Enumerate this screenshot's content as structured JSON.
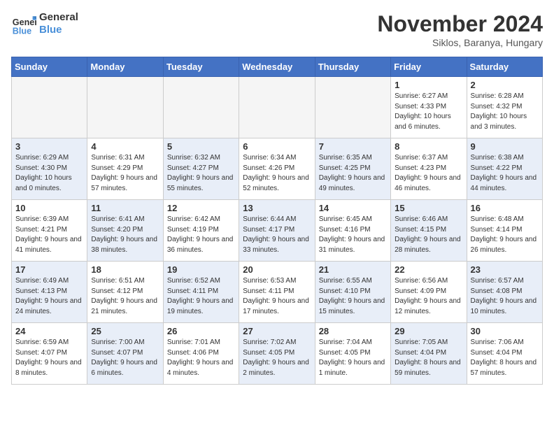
{
  "header": {
    "logo_line1": "General",
    "logo_line2": "Blue",
    "month_title": "November 2024",
    "location": "Siklos, Baranya, Hungary"
  },
  "days_of_week": [
    "Sunday",
    "Monday",
    "Tuesday",
    "Wednesday",
    "Thursday",
    "Friday",
    "Saturday"
  ],
  "weeks": [
    [
      {
        "day": "",
        "empty": true
      },
      {
        "day": "",
        "empty": true
      },
      {
        "day": "",
        "empty": true
      },
      {
        "day": "",
        "empty": true
      },
      {
        "day": "",
        "empty": true
      },
      {
        "day": "1",
        "sunrise": "Sunrise: 6:27 AM",
        "sunset": "Sunset: 4:33 PM",
        "daylight": "Daylight: 10 hours and 6 minutes."
      },
      {
        "day": "2",
        "sunrise": "Sunrise: 6:28 AM",
        "sunset": "Sunset: 4:32 PM",
        "daylight": "Daylight: 10 hours and 3 minutes."
      }
    ],
    [
      {
        "day": "3",
        "sunrise": "Sunrise: 6:29 AM",
        "sunset": "Sunset: 4:30 PM",
        "daylight": "Daylight: 10 hours and 0 minutes.",
        "shaded": true
      },
      {
        "day": "4",
        "sunrise": "Sunrise: 6:31 AM",
        "sunset": "Sunset: 4:29 PM",
        "daylight": "Daylight: 9 hours and 57 minutes.",
        "shaded": false
      },
      {
        "day": "5",
        "sunrise": "Sunrise: 6:32 AM",
        "sunset": "Sunset: 4:27 PM",
        "daylight": "Daylight: 9 hours and 55 minutes.",
        "shaded": true
      },
      {
        "day": "6",
        "sunrise": "Sunrise: 6:34 AM",
        "sunset": "Sunset: 4:26 PM",
        "daylight": "Daylight: 9 hours and 52 minutes.",
        "shaded": false
      },
      {
        "day": "7",
        "sunrise": "Sunrise: 6:35 AM",
        "sunset": "Sunset: 4:25 PM",
        "daylight": "Daylight: 9 hours and 49 minutes.",
        "shaded": true
      },
      {
        "day": "8",
        "sunrise": "Sunrise: 6:37 AM",
        "sunset": "Sunset: 4:23 PM",
        "daylight": "Daylight: 9 hours and 46 minutes.",
        "shaded": false
      },
      {
        "day": "9",
        "sunrise": "Sunrise: 6:38 AM",
        "sunset": "Sunset: 4:22 PM",
        "daylight": "Daylight: 9 hours and 44 minutes.",
        "shaded": true
      }
    ],
    [
      {
        "day": "10",
        "sunrise": "Sunrise: 6:39 AM",
        "sunset": "Sunset: 4:21 PM",
        "daylight": "Daylight: 9 hours and 41 minutes.",
        "shaded": false
      },
      {
        "day": "11",
        "sunrise": "Sunrise: 6:41 AM",
        "sunset": "Sunset: 4:20 PM",
        "daylight": "Daylight: 9 hours and 38 minutes.",
        "shaded": true
      },
      {
        "day": "12",
        "sunrise": "Sunrise: 6:42 AM",
        "sunset": "Sunset: 4:19 PM",
        "daylight": "Daylight: 9 hours and 36 minutes.",
        "shaded": false
      },
      {
        "day": "13",
        "sunrise": "Sunrise: 6:44 AM",
        "sunset": "Sunset: 4:17 PM",
        "daylight": "Daylight: 9 hours and 33 minutes.",
        "shaded": true
      },
      {
        "day": "14",
        "sunrise": "Sunrise: 6:45 AM",
        "sunset": "Sunset: 4:16 PM",
        "daylight": "Daylight: 9 hours and 31 minutes.",
        "shaded": false
      },
      {
        "day": "15",
        "sunrise": "Sunrise: 6:46 AM",
        "sunset": "Sunset: 4:15 PM",
        "daylight": "Daylight: 9 hours and 28 minutes.",
        "shaded": true
      },
      {
        "day": "16",
        "sunrise": "Sunrise: 6:48 AM",
        "sunset": "Sunset: 4:14 PM",
        "daylight": "Daylight: 9 hours and 26 minutes.",
        "shaded": false
      }
    ],
    [
      {
        "day": "17",
        "sunrise": "Sunrise: 6:49 AM",
        "sunset": "Sunset: 4:13 PM",
        "daylight": "Daylight: 9 hours and 24 minutes.",
        "shaded": true
      },
      {
        "day": "18",
        "sunrise": "Sunrise: 6:51 AM",
        "sunset": "Sunset: 4:12 PM",
        "daylight": "Daylight: 9 hours and 21 minutes.",
        "shaded": false
      },
      {
        "day": "19",
        "sunrise": "Sunrise: 6:52 AM",
        "sunset": "Sunset: 4:11 PM",
        "daylight": "Daylight: 9 hours and 19 minutes.",
        "shaded": true
      },
      {
        "day": "20",
        "sunrise": "Sunrise: 6:53 AM",
        "sunset": "Sunset: 4:11 PM",
        "daylight": "Daylight: 9 hours and 17 minutes.",
        "shaded": false
      },
      {
        "day": "21",
        "sunrise": "Sunrise: 6:55 AM",
        "sunset": "Sunset: 4:10 PM",
        "daylight": "Daylight: 9 hours and 15 minutes.",
        "shaded": true
      },
      {
        "day": "22",
        "sunrise": "Sunrise: 6:56 AM",
        "sunset": "Sunset: 4:09 PM",
        "daylight": "Daylight: 9 hours and 12 minutes.",
        "shaded": false
      },
      {
        "day": "23",
        "sunrise": "Sunrise: 6:57 AM",
        "sunset": "Sunset: 4:08 PM",
        "daylight": "Daylight: 9 hours and 10 minutes.",
        "shaded": true
      }
    ],
    [
      {
        "day": "24",
        "sunrise": "Sunrise: 6:59 AM",
        "sunset": "Sunset: 4:07 PM",
        "daylight": "Daylight: 9 hours and 8 minutes.",
        "shaded": false
      },
      {
        "day": "25",
        "sunrise": "Sunrise: 7:00 AM",
        "sunset": "Sunset: 4:07 PM",
        "daylight": "Daylight: 9 hours and 6 minutes.",
        "shaded": true
      },
      {
        "day": "26",
        "sunrise": "Sunrise: 7:01 AM",
        "sunset": "Sunset: 4:06 PM",
        "daylight": "Daylight: 9 hours and 4 minutes.",
        "shaded": false
      },
      {
        "day": "27",
        "sunrise": "Sunrise: 7:02 AM",
        "sunset": "Sunset: 4:05 PM",
        "daylight": "Daylight: 9 hours and 2 minutes.",
        "shaded": true
      },
      {
        "day": "28",
        "sunrise": "Sunrise: 7:04 AM",
        "sunset": "Sunset: 4:05 PM",
        "daylight": "Daylight: 9 hours and 1 minute.",
        "shaded": false
      },
      {
        "day": "29",
        "sunrise": "Sunrise: 7:05 AM",
        "sunset": "Sunset: 4:04 PM",
        "daylight": "Daylight: 8 hours and 59 minutes.",
        "shaded": true
      },
      {
        "day": "30",
        "sunrise": "Sunrise: 7:06 AM",
        "sunset": "Sunset: 4:04 PM",
        "daylight": "Daylight: 8 hours and 57 minutes.",
        "shaded": false
      }
    ]
  ]
}
